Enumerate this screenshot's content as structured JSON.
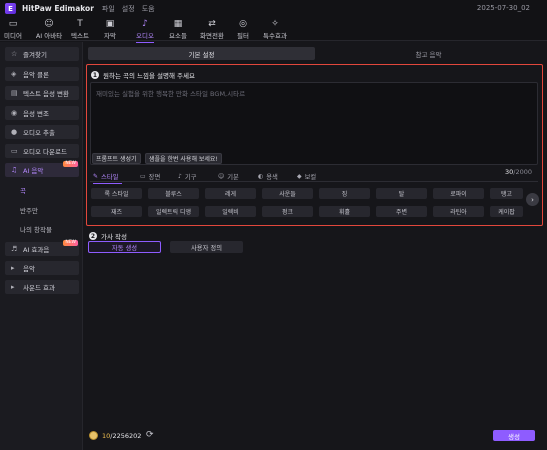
{
  "app": {
    "name": "HitPaw Edimakor",
    "logo_letter": "E",
    "menu": [
      "파일",
      "설정",
      "도움"
    ],
    "date": "2025-07-30_02"
  },
  "toolbar": [
    {
      "label": "미디어",
      "icon": "folder-icon",
      "glyph": "▭"
    },
    {
      "label": "AI 아바타",
      "icon": "avatar-icon",
      "glyph": "☺"
    },
    {
      "label": "텍스트",
      "icon": "text-icon",
      "glyph": "T"
    },
    {
      "label": "자막",
      "icon": "subtitle-icon",
      "glyph": "▣"
    },
    {
      "label": "오디오",
      "icon": "music-icon",
      "glyph": "♪"
    },
    {
      "label": "요소들",
      "icon": "elements-icon",
      "glyph": "▦"
    },
    {
      "label": "화면전환",
      "icon": "transition-icon",
      "glyph": "⇄"
    },
    {
      "label": "필터",
      "icon": "filter-icon",
      "glyph": "◎"
    },
    {
      "label": "특수효과",
      "icon": "effects-icon",
      "glyph": "✧"
    }
  ],
  "sidebar": {
    "items": [
      {
        "label": "즐겨찾기",
        "icon": "star-icon",
        "glyph": "☆"
      },
      {
        "label": "음악 클론",
        "icon": "clone-icon",
        "glyph": "◈"
      },
      {
        "label": "텍스트 음성 변환",
        "icon": "tts-icon",
        "glyph": "▤"
      },
      {
        "label": "음성 변조",
        "icon": "voice-changer-icon",
        "glyph": "◉"
      },
      {
        "label": "오디오 추출",
        "icon": "mic-icon",
        "glyph": "🎙"
      },
      {
        "label": "오디오 다운로드",
        "icon": "download-icon",
        "glyph": "▭"
      },
      {
        "label": "AI 음악",
        "icon": "ai-music-icon",
        "glyph": "♫",
        "badge": "NEW"
      },
      {
        "label": "AI 효과음",
        "icon": "ai-sfx-icon",
        "glyph": "♬",
        "badge": "NEW"
      },
      {
        "label": "음악",
        "icon": "caret-right-icon",
        "glyph": "▸"
      },
      {
        "label": "사운드 효과",
        "icon": "caret-right-icon",
        "glyph": "▸"
      }
    ],
    "sub_items": [
      "곡",
      "반주만",
      "나의 창작물"
    ]
  },
  "tabs": [
    "기본 설정",
    "참고 음악"
  ],
  "prompt": {
    "step": "1",
    "title": "원하는 곡의 느낌을 설명해 주세요",
    "placeholder": "재미있는 실험을 위한 행복한 만화 스타일 BGM,시타르",
    "count_current": "30",
    "count_max": "/2000",
    "generate_prompt_button": "프롬프트 생성기",
    "use_sample_button": "샘플을 한번 사용해 보세요!"
  },
  "categories": [
    {
      "label": "스타일",
      "icon": "palette-icon",
      "glyph": "✎"
    },
    {
      "label": "장면",
      "icon": "scene-icon",
      "glyph": "▭"
    },
    {
      "label": "기구",
      "icon": "instrument-icon",
      "glyph": "♪"
    },
    {
      "label": "기분",
      "icon": "mood-icon",
      "glyph": "☺"
    },
    {
      "label": "용색",
      "icon": "tone-icon",
      "glyph": "◐"
    },
    {
      "label": "보컬",
      "icon": "vocal-icon",
      "glyph": "◆"
    }
  ],
  "styles_row1": [
    "록 스타일",
    "블루스",
    "레게",
    "사운들",
    "징",
    "탈",
    "로파이",
    "탱고"
  ],
  "styles_row2": [
    "재즈",
    "일렉트릭 디앵",
    "일렉비",
    "펑크",
    "휘휼",
    "주변",
    "라틴아",
    "케이팝"
  ],
  "lyrics": {
    "step": "2",
    "title": "가사 작성",
    "auto_button": "자동 생성",
    "custom_button": "사용자 정의"
  },
  "footer": {
    "credits_used": "10",
    "credits_total": "/2256202",
    "generate_button": "생성"
  },
  "colors": {
    "accent": "#8e5cff",
    "highlight_border": "#e2473c",
    "coin": "#e8c36a"
  }
}
